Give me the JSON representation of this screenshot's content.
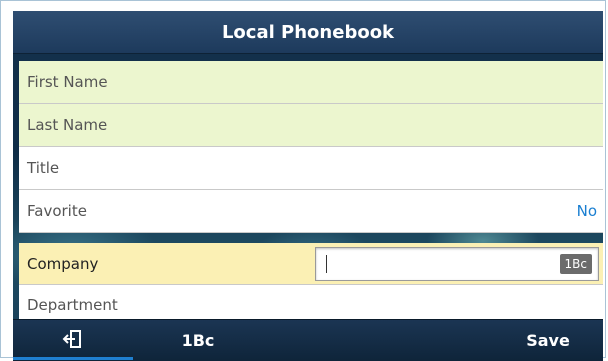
{
  "header": {
    "title": "Local Phonebook"
  },
  "fields": [
    {
      "label": "First Name",
      "value": ""
    },
    {
      "label": "Last Name",
      "value": ""
    },
    {
      "label": "Title",
      "value": ""
    },
    {
      "label": "Favorite",
      "value": "No"
    }
  ],
  "company": {
    "label": "Company",
    "value": "",
    "input_mode_badge": "1Bc"
  },
  "department": {
    "label": "Department"
  },
  "softkeys": {
    "input_mode": "1Bc",
    "save": "Save"
  },
  "icons": {
    "back": "back-exit-icon"
  },
  "colors": {
    "accent": "#1a7fd1",
    "highlight": "#fbf0b4",
    "editable_row": "#ecf6cf"
  }
}
